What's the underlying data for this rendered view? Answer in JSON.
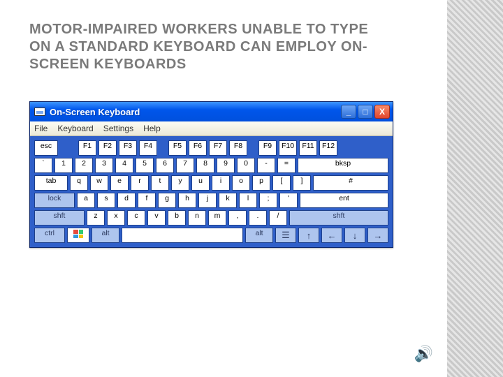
{
  "slide": {
    "title": "MOTOR-IMPAIRED WORKERS UNABLE TO TYPE ON A STANDARD KEYBOARD CAN EMPLOY ON-SCREEN KEYBOARDS"
  },
  "window": {
    "title": "On-Screen Keyboard",
    "minimize": "_",
    "maximize": "□",
    "close": "X"
  },
  "menu": {
    "file": "File",
    "keyboard": "Keyboard",
    "settings": "Settings",
    "help": "Help"
  },
  "rows": {
    "r0": {
      "esc": "esc",
      "f1": "F1",
      "f2": "F2",
      "f3": "F3",
      "f4": "F4",
      "f5": "F5",
      "f6": "F6",
      "f7": "F7",
      "f8": "F8",
      "f9": "F9",
      "f10": "F10",
      "f11": "F11",
      "f12": "F12"
    },
    "r1": {
      "backtick": "`",
      "n1": "1",
      "n2": "2",
      "n3": "3",
      "n4": "4",
      "n5": "5",
      "n6": "6",
      "n7": "7",
      "n8": "8",
      "n9": "9",
      "n0": "0",
      "minus": "-",
      "equals": "=",
      "bksp": "bksp"
    },
    "r2": {
      "tab": "tab",
      "q": "q",
      "w": "w",
      "e": "e",
      "r": "r",
      "t": "t",
      "y": "y",
      "u": "u",
      "i": "i",
      "o": "o",
      "p": "p",
      "lbr": "[",
      "rbr": "]",
      "bslash": "#"
    },
    "r3": {
      "lock": "lock",
      "a": "a",
      "s": "s",
      "d": "d",
      "f": "f",
      "g": "g",
      "h": "h",
      "j": "j",
      "k": "k",
      "l": "l",
      "semi": ";",
      "apos": "'",
      "ent": "ent"
    },
    "r4": {
      "lshft": "shft",
      "z": "z",
      "x": "x",
      "c": "c",
      "v": "v",
      "b": "b",
      "n": "n",
      "m": "m",
      "comma": ",",
      "period": ".",
      "slash": "/",
      "rshft": "shft"
    },
    "r5": {
      "ctrl": "ctrl",
      "alt": "alt",
      "ralt": "alt",
      "menu": "☰",
      "up": "↑",
      "left": "←",
      "down": "↓",
      "right": "→"
    }
  }
}
